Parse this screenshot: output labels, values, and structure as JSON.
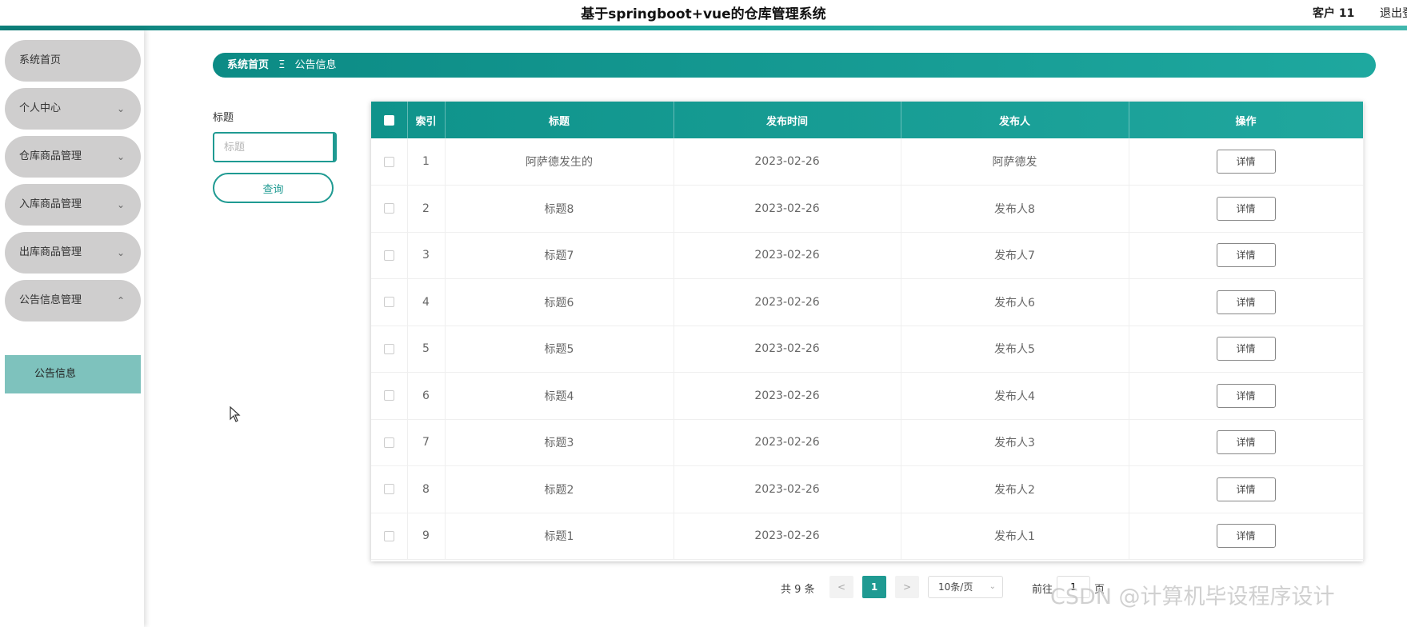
{
  "header": {
    "title": "基于springboot+vue的仓库管理系统",
    "user": "客户 11",
    "logout": "退出登"
  },
  "sidebar": {
    "items": [
      {
        "label": "系统首页",
        "has_chevron": false
      },
      {
        "label": "个人中心",
        "chevron": "⌄"
      },
      {
        "label": "仓库商品管理",
        "chevron": "⌄"
      },
      {
        "label": "入库商品管理",
        "chevron": "⌄"
      },
      {
        "label": "出库商品管理",
        "chevron": "⌄"
      },
      {
        "label": "公告信息管理",
        "chevron": "⌃"
      }
    ],
    "active_submenu": "公告信息"
  },
  "breadcrumb": {
    "home": "系统首页",
    "separator": "Ξ",
    "current": "公告信息"
  },
  "search": {
    "label": "标题",
    "placeholder": "标题",
    "button": "查询"
  },
  "table": {
    "columns": [
      "索引",
      "标题",
      "发布时间",
      "发布人",
      "操作"
    ],
    "action_label": "详情",
    "rows": [
      {
        "index": "1",
        "title": "阿萨德发生的",
        "date": "2023-02-26",
        "publisher": "阿萨德发"
      },
      {
        "index": "2",
        "title": "标题8",
        "date": "2023-02-26",
        "publisher": "发布人8"
      },
      {
        "index": "3",
        "title": "标题7",
        "date": "2023-02-26",
        "publisher": "发布人7"
      },
      {
        "index": "4",
        "title": "标题6",
        "date": "2023-02-26",
        "publisher": "发布人6"
      },
      {
        "index": "5",
        "title": "标题5",
        "date": "2023-02-26",
        "publisher": "发布人5"
      },
      {
        "index": "6",
        "title": "标题4",
        "date": "2023-02-26",
        "publisher": "发布人4"
      },
      {
        "index": "7",
        "title": "标题3",
        "date": "2023-02-26",
        "publisher": "发布人3"
      },
      {
        "index": "8",
        "title": "标题2",
        "date": "2023-02-26",
        "publisher": "发布人2"
      },
      {
        "index": "9",
        "title": "标题1",
        "date": "2023-02-26",
        "publisher": "发布人1"
      }
    ]
  },
  "pagination": {
    "total": "共 9 条",
    "prev": "<",
    "current_page": "1",
    "next": ">",
    "page_size": "10条/页",
    "goto_label": "前往",
    "goto_value": "1",
    "page_unit": "页"
  },
  "watermark": "CSDN @计算机毕设程序设计",
  "colors": {
    "accent": "#1f9a92",
    "menu_bg": "#cfcece",
    "submenu_active": "#7ec2bd"
  }
}
